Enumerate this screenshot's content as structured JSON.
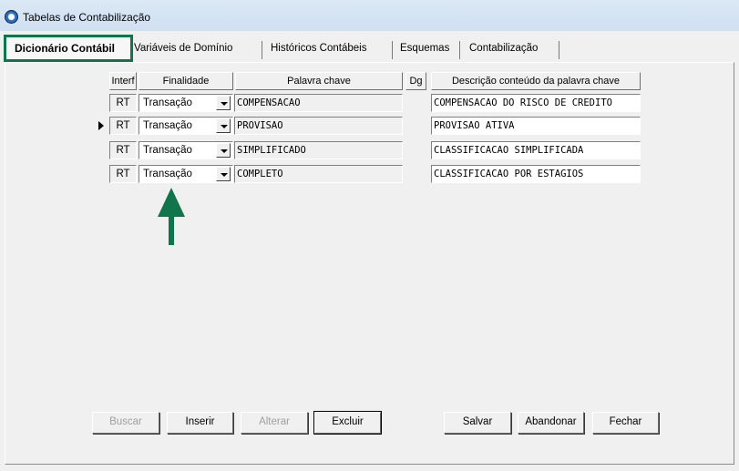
{
  "window": {
    "title": "Tabelas de Contabilização"
  },
  "tabs": [
    {
      "label": "Dicionário Contábil",
      "active": true
    },
    {
      "label": "Variáveis de Domínio"
    },
    {
      "label": "Históricos Contábeis"
    },
    {
      "label": "Esquemas"
    },
    {
      "label": "Contabilização"
    }
  ],
  "grid": {
    "headers": {
      "interf": "Interf",
      "finalidade": "Finalidade",
      "palavra": "Palavra chave",
      "dg": "Dg",
      "descricao": "Descrição conteúdo da palavra chave"
    },
    "rows": [
      {
        "interf": "RT",
        "finalidade": "Transação",
        "palavra": "COMPENSACAO",
        "dg": "",
        "descricao": "COMPENSACAO DO RISCO DE CREDITO",
        "current": false
      },
      {
        "interf": "RT",
        "finalidade": "Transação",
        "palavra": "PROVISAO",
        "dg": "",
        "descricao": "PROVISAO ATIVA",
        "current": true
      },
      {
        "interf": "RT",
        "finalidade": "Transação",
        "palavra": "SIMPLIFICADO",
        "dg": "",
        "descricao": "CLASSIFICACAO SIMPLIFICADA",
        "current": false
      },
      {
        "interf": "RT",
        "finalidade": "Transação",
        "palavra": "COMPLETO",
        "dg": "",
        "descricao": "CLASSIFICACAO POR ESTAGIOS",
        "current": false
      }
    ]
  },
  "buttons": {
    "buscar": "Buscar",
    "inserir": "Inserir",
    "alterar": "Alterar",
    "excluir": "Excluir",
    "salvar": "Salvar",
    "abandonar": "Abandonar",
    "fechar": "Fechar"
  },
  "annotation": {
    "arrow_color": "#10754a",
    "highlight_color": "#10754a"
  }
}
